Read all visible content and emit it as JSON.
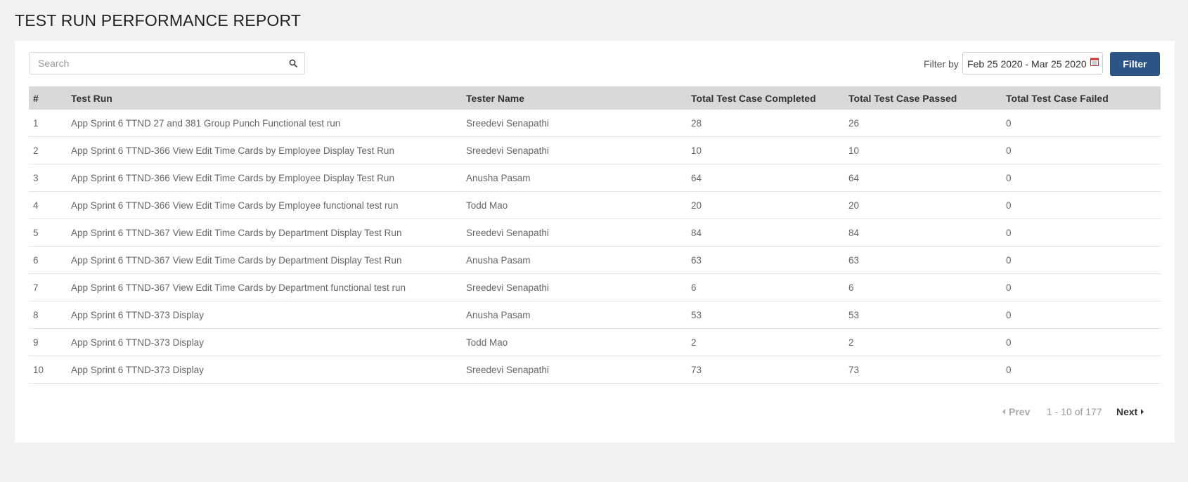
{
  "page": {
    "title": "TEST RUN PERFORMANCE REPORT"
  },
  "search": {
    "placeholder": "Search",
    "value": ""
  },
  "filter": {
    "label": "Filter by",
    "date_range": "Feb 25 2020 - Mar 25 2020",
    "button_label": "Filter",
    "button_color": "#2d5486"
  },
  "table": {
    "columns": [
      "#",
      "Test Run",
      "Tester Name",
      "Total Test Case Completed",
      "Total Test Case Passed",
      "Total Test Case Failed"
    ],
    "rows": [
      [
        "1",
        "App Sprint 6 TTND 27 and 381 Group Punch Functional test run",
        "Sreedevi Senapathi",
        "28",
        "26",
        "0"
      ],
      [
        "2",
        "App Sprint 6 TTND-366 View Edit Time Cards by Employee Display Test Run",
        "Sreedevi Senapathi",
        "10",
        "10",
        "0"
      ],
      [
        "3",
        "App Sprint 6 TTND-366 View Edit Time Cards by Employee Display Test Run",
        "Anusha Pasam",
        "64",
        "64",
        "0"
      ],
      [
        "4",
        "App Sprint 6 TTND-366 View Edit Time Cards by Employee functional test run",
        "Todd Mao",
        "20",
        "20",
        "0"
      ],
      [
        "5",
        "App Sprint 6 TTND-367 View Edit Time Cards by Department Display Test Run",
        "Sreedevi Senapathi",
        "84",
        "84",
        "0"
      ],
      [
        "6",
        "App Sprint 6 TTND-367 View Edit Time Cards by Department Display Test Run",
        "Anusha Pasam",
        "63",
        "63",
        "0"
      ],
      [
        "7",
        "App Sprint 6 TTND-367 View Edit Time Cards by Department functional test run",
        "Sreedevi Senapathi",
        "6",
        "6",
        "0"
      ],
      [
        "8",
        "App Sprint 6 TTND-373 Display",
        "Anusha Pasam",
        "53",
        "53",
        "0"
      ],
      [
        "9",
        "App Sprint 6 TTND-373 Display",
        "Todd Mao",
        "2",
        "2",
        "0"
      ],
      [
        "10",
        "App Sprint 6 TTND-373 Display",
        "Sreedevi Senapathi",
        "73",
        "73",
        "0"
      ]
    ]
  },
  "pagination": {
    "prev_label": "Prev",
    "page_info": "1 - 10 of 177",
    "next_label": "Next"
  },
  "icons": {
    "search": "search-icon",
    "calendar": "calendar-icon",
    "prev": "caret-left-icon",
    "next": "caret-right-icon"
  }
}
